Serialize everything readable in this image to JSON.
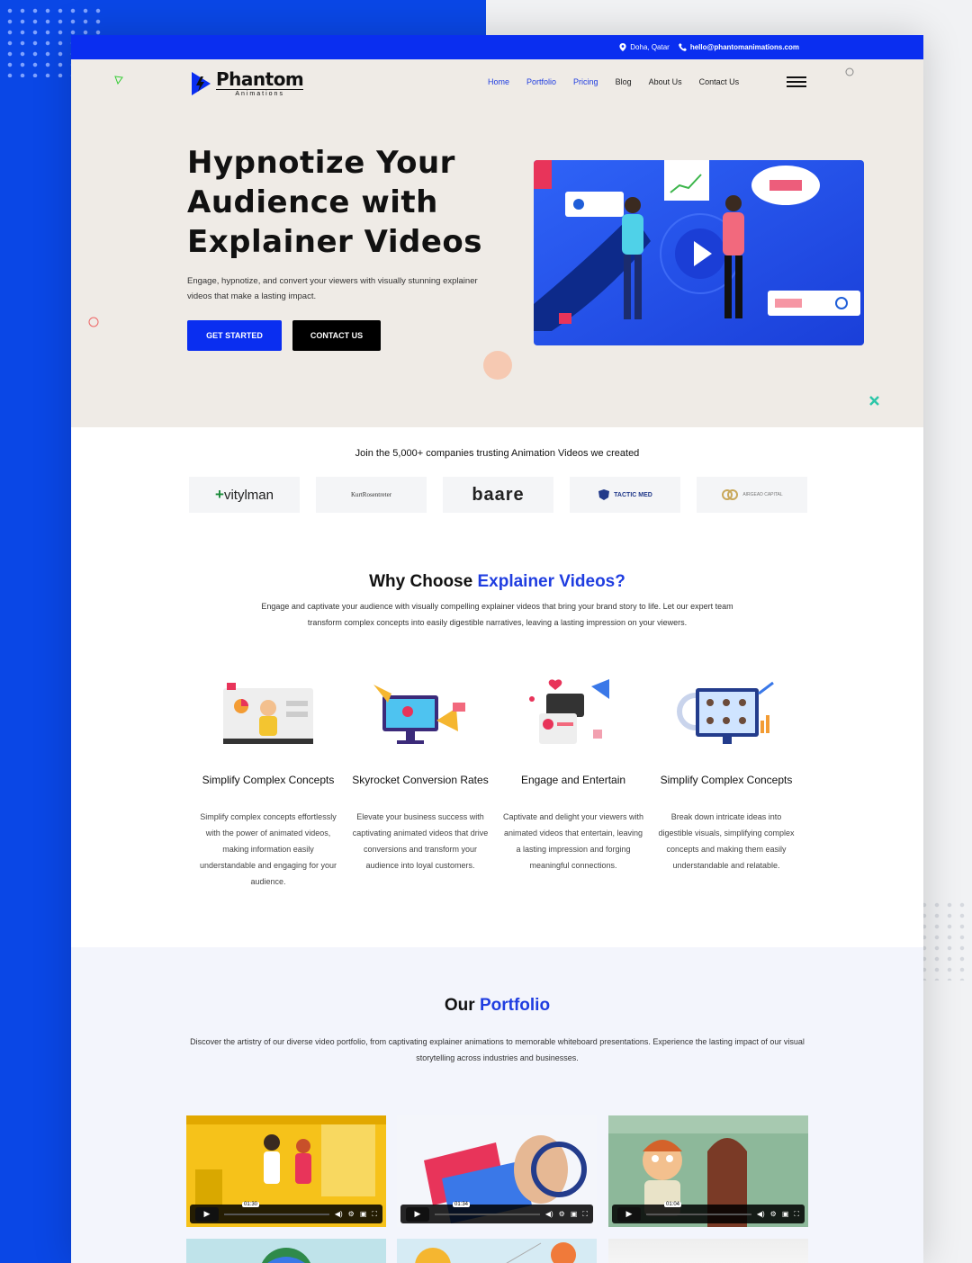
{
  "topbar": {
    "location": "Doha, Qatar",
    "email": "hello@phantomanimations.com"
  },
  "brand": {
    "name": "Phantom",
    "sub": "Animations"
  },
  "nav": [
    "Home",
    "Portfolio",
    "Pricing",
    "Blog",
    "About Us",
    "Contact Us"
  ],
  "hero": {
    "title": "Hypnotize Your Audience with Explainer Videos",
    "text": "Engage, hypnotize, and convert your viewers with visually stunning explainer videos that make a lasting impact.",
    "btn_primary": "GET STARTED",
    "btn_secondary": "CONTACT US"
  },
  "trust": {
    "text": "Join the 5,000+ companies trusting Animation Videos we created",
    "logos": [
      "vitylman",
      "KurtRosentreter",
      "baare",
      "TACTIC MED",
      "AIRGEAD CAPITAL"
    ]
  },
  "why": {
    "title_a": "Why Choose ",
    "title_b": "Explainer Videos?",
    "desc": "Engage and captivate your audience with visually compelling explainer videos that bring your brand story to life. Let our expert team transform complex concepts into easily digestible narratives, leaving a lasting impression on your viewers.",
    "features": [
      {
        "title": "Simplify Complex Concepts",
        "text": "Simplify complex concepts effortlessly with the power of animated videos, making information easily understandable and engaging for your audience."
      },
      {
        "title": "Skyrocket Conversion Rates",
        "text": "Elevate your business success with captivating animated videos that drive conversions and transform your audience into loyal customers."
      },
      {
        "title": "Engage and Entertain",
        "text": "Captivate and delight your viewers with animated videos that entertain, leaving a lasting impression and forging meaningful connections."
      },
      {
        "title": "Simplify Complex Concepts",
        "text": "Break down intricate ideas into digestible visuals, simplifying complex concepts and making them easily understandable and relatable."
      }
    ]
  },
  "portfolio": {
    "title_a": "Our ",
    "title_b": "Portfolio",
    "desc": "Discover the artistry of our diverse video portfolio, from captivating explainer animations to memorable whiteboard presentations. Experience the lasting impact of our visual storytelling across industries and businesses.",
    "videos": [
      {
        "time": "01:30"
      },
      {
        "time": "01:34"
      },
      {
        "time": "01:04"
      }
    ]
  },
  "colors": {
    "primary": "#0a2ef0",
    "hero_bg": "#efebe6",
    "portfolio_bg": "#f3f5fc"
  }
}
